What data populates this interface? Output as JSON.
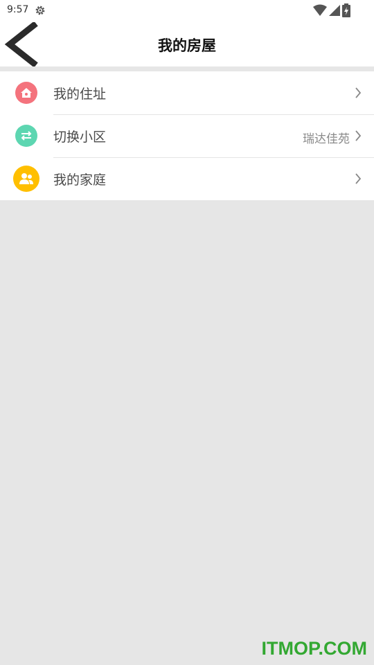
{
  "status_bar": {
    "time": "9:57",
    "icons": [
      "settings-icon",
      "wifi-icon",
      "signal-icon",
      "battery-charging-icon"
    ]
  },
  "header": {
    "title": "我的房屋",
    "back_icon": "back-arrow-icon"
  },
  "menu": {
    "items": [
      {
        "label": "我的住址",
        "value": "",
        "icon": "house-icon",
        "icon_color": "#f4737d"
      },
      {
        "label": "切换小区",
        "value": "瑞达佳苑",
        "icon": "swap-arrows-icon",
        "icon_color": "#5dd6b1"
      },
      {
        "label": "我的家庭",
        "value": "",
        "icon": "family-icon",
        "icon_color": "#ffbf00"
      }
    ]
  },
  "watermark": "ITMOP.COM",
  "colors": {
    "background": "#e6e6e6",
    "surface": "#ffffff",
    "watermark": "#33a832"
  }
}
